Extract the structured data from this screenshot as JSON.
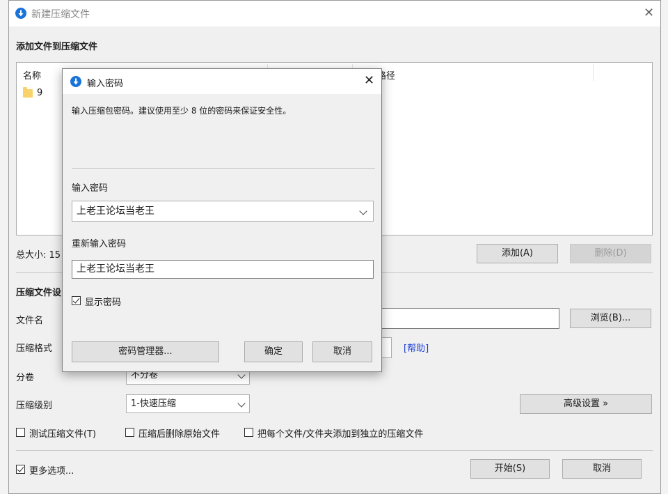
{
  "main": {
    "title": "新建压缩文件",
    "add_section_title": "添加文件到压缩文件",
    "file_list": {
      "col_name": "名称",
      "col_path_partial": "路径",
      "items": [
        {
          "name": "9"
        }
      ]
    },
    "total_size_label": "总大小: 15",
    "add_button": "添加(A)",
    "delete_button": "删除(D)",
    "settings_title_partial": "压缩文件设",
    "filename_label": "文件名",
    "browse_button": "浏览(B)...",
    "format_label": "压缩格式",
    "help_link": "[帮助]",
    "split_label": "分卷",
    "split_value_partial": "不分卷",
    "level_label": "压缩级别",
    "level_value": "1-快速压缩",
    "advanced_button": "高级设置 »",
    "opt_test": "测试压缩文件(T)",
    "opt_delete_after": "压缩后删除原始文件",
    "opt_each_separate": "把每个文件/文件夹添加到独立的压缩文件",
    "more_options": "更多选项...",
    "start_button": "开始(S)",
    "cancel_button": "取消"
  },
  "password_dialog": {
    "title": "输入密码",
    "description": "输入压缩包密码。建议使用至少 8 位的密码来保证安全性。",
    "password_label": "输入密码",
    "password_value": "上老王论坛当老王",
    "reenter_label": "重新输入密码",
    "reenter_value": "上老王论坛当老王",
    "show_password": "显示密码",
    "show_password_checked": true,
    "manager_button": "密码管理器...",
    "ok_button": "确定",
    "cancel_button": "取消"
  },
  "colors": {
    "accent": "#1a73d9",
    "link": "#1a3fd6"
  }
}
